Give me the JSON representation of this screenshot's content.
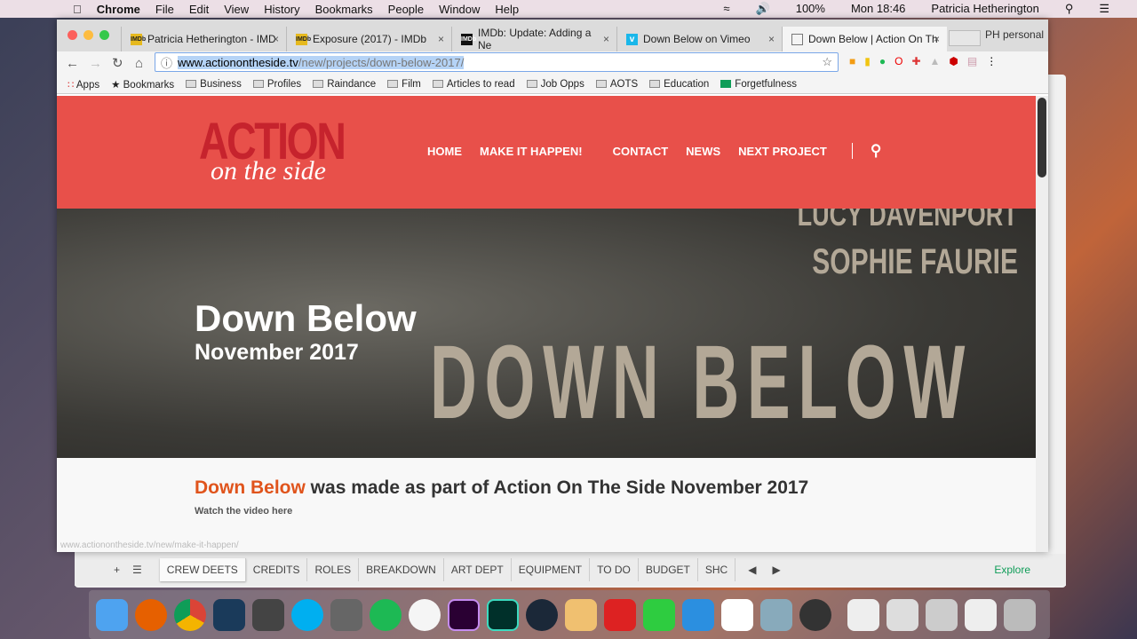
{
  "menubar": {
    "items": [
      "Chrome",
      "File",
      "Edit",
      "View",
      "History",
      "Bookmarks",
      "People",
      "Window",
      "Help"
    ],
    "battery": "100%",
    "clock": "Mon 18:46",
    "user": "Patricia Hetherington"
  },
  "tabs": [
    {
      "label": "Patricia Hetherington - IMD",
      "icon": "imdb-icon"
    },
    {
      "label": "Exposure (2017) - IMDb",
      "icon": "imdb-icon"
    },
    {
      "label": "IMDb: Update: Adding a Ne",
      "icon": "imdb-icon"
    },
    {
      "label": "Down Below on Vimeo",
      "icon": "vimeo-icon"
    },
    {
      "label": "Down Below | Action On Th",
      "icon": "page-icon",
      "active": true
    }
  ],
  "profile": "PH personal",
  "url": {
    "host": "www.actionontheside.tv",
    "path": "/new/projects/down-below-2017/"
  },
  "bookmarks": [
    "Apps",
    "Bookmarks",
    "Business",
    "Profiles",
    "Raindance",
    "Film",
    "Articles to read",
    "Job Opps",
    "AOTS",
    "Education",
    "Forgetfulness"
  ],
  "site": {
    "logo_top": "ACTION",
    "logo_bottom": "on the side",
    "nav": [
      "HOME",
      "MAKE IT HAPPEN!",
      "CONTACT",
      "NEWS",
      "NEXT PROJECT"
    ],
    "accent": "#e8504a"
  },
  "hero": {
    "title": "Down Below",
    "subtitle": "November 2017",
    "poster_title": "DOWN BELOW",
    "credit1": "LUCY DAVENPORT",
    "credit2": "SOPHIE FAURIE"
  },
  "content": {
    "highlight": "Down Below",
    "heading_rest": " was made as part of Action On The Side November 2017",
    "subtext": "Watch the video here"
  },
  "status_url": "www.actionontheside.tv/new/make-it-happen/",
  "sheet": {
    "tabs": [
      "CREW DEETS",
      "CREDITS",
      "ROLES",
      "BREAKDOWN",
      "ART DEPT",
      "EQUIPMENT",
      "TO DO",
      "BUDGET",
      "SHC"
    ],
    "explore": "Explore"
  }
}
